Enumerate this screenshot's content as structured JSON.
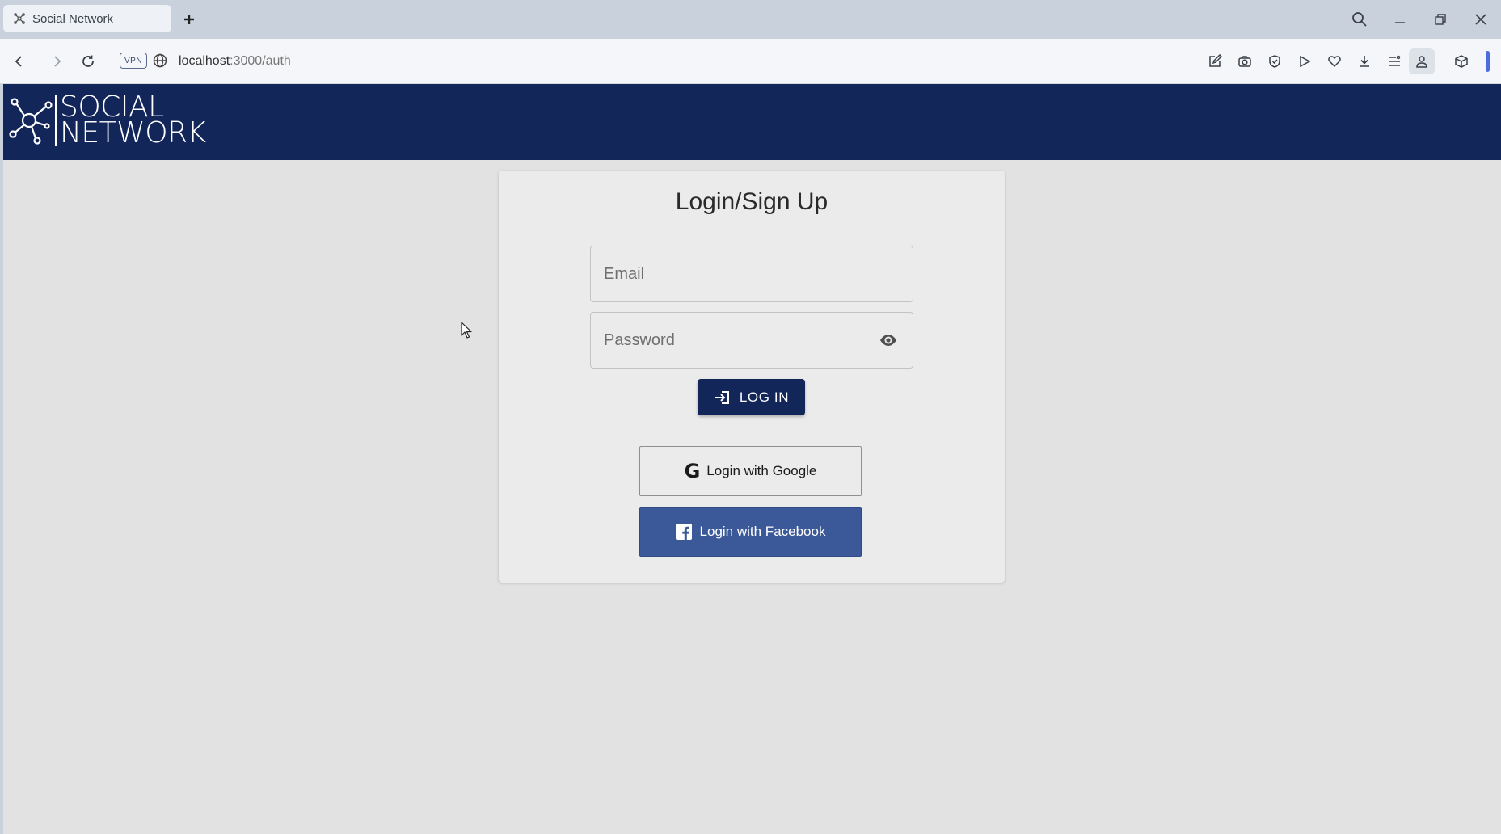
{
  "browser": {
    "tab_title": "Social Network",
    "vpn_label": "VPN",
    "url_host": "localhost",
    "url_path": ":3000/auth"
  },
  "header": {
    "logo_line1": "SOCIAL",
    "logo_line2": "NETWORK",
    "background": "#13265a"
  },
  "auth": {
    "title": "Login/Sign Up",
    "email_placeholder": "Email",
    "password_placeholder": "Password",
    "login_label": "LOG IN",
    "google_label": "Login with Google",
    "facebook_label": "Login with Facebook",
    "google_icon": "G",
    "facebook_icon": "f"
  },
  "colors": {
    "primary": "#13265a",
    "facebook": "#3b5998",
    "page_background": "#e2e2e2",
    "card_background": "#ebebeb"
  },
  "icons": {
    "tab": "network-icon",
    "password_toggle": "eye-icon",
    "login": "login-arrow-icon",
    "google": "google-icon",
    "facebook": "facebook-icon"
  }
}
